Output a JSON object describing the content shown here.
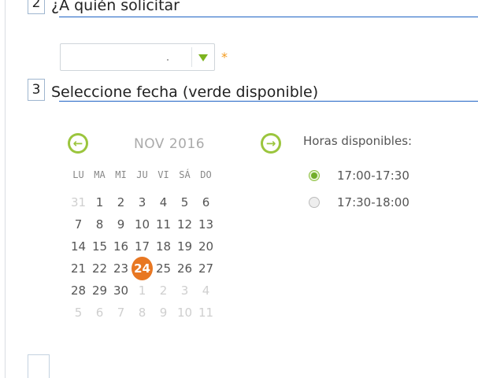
{
  "steps": [
    {
      "number": "2",
      "title": "¿A quién solicitar"
    },
    {
      "number": "3",
      "title": "Seleccione fecha (verde disponible)"
    }
  ],
  "select": {
    "value": "",
    "required_mark": "*"
  },
  "calendar": {
    "month_label": "NOV 2016",
    "prev_label": "←",
    "next_label": "→",
    "weekdays": [
      "LU",
      "MA",
      "MI",
      "JU",
      "VI",
      "SÁ",
      "DO"
    ],
    "days": [
      [
        "31",
        "1",
        "2",
        "3",
        "4",
        "5",
        "6"
      ],
      [
        "7",
        "8",
        "9",
        "10",
        "11",
        "12",
        "13"
      ],
      [
        "14",
        "15",
        "16",
        "17",
        "18",
        "19",
        "20"
      ],
      [
        "21",
        "22",
        "23",
        "24",
        "25",
        "26",
        "27"
      ],
      [
        "28",
        "29",
        "30",
        "1",
        "2",
        "3",
        "4"
      ],
      [
        "5",
        "6",
        "7",
        "8",
        "9",
        "10",
        "11"
      ]
    ],
    "selected_day": "24"
  },
  "hours": {
    "title": "Horas disponibles:",
    "slots": [
      {
        "label": "17:00-17:30",
        "selected": true
      },
      {
        "label": "17:30-18:00",
        "selected": false
      }
    ]
  },
  "colors": {
    "accent_green": "#9bc53d",
    "selected_orange": "#e87722",
    "step_line": "#1e63c4"
  }
}
